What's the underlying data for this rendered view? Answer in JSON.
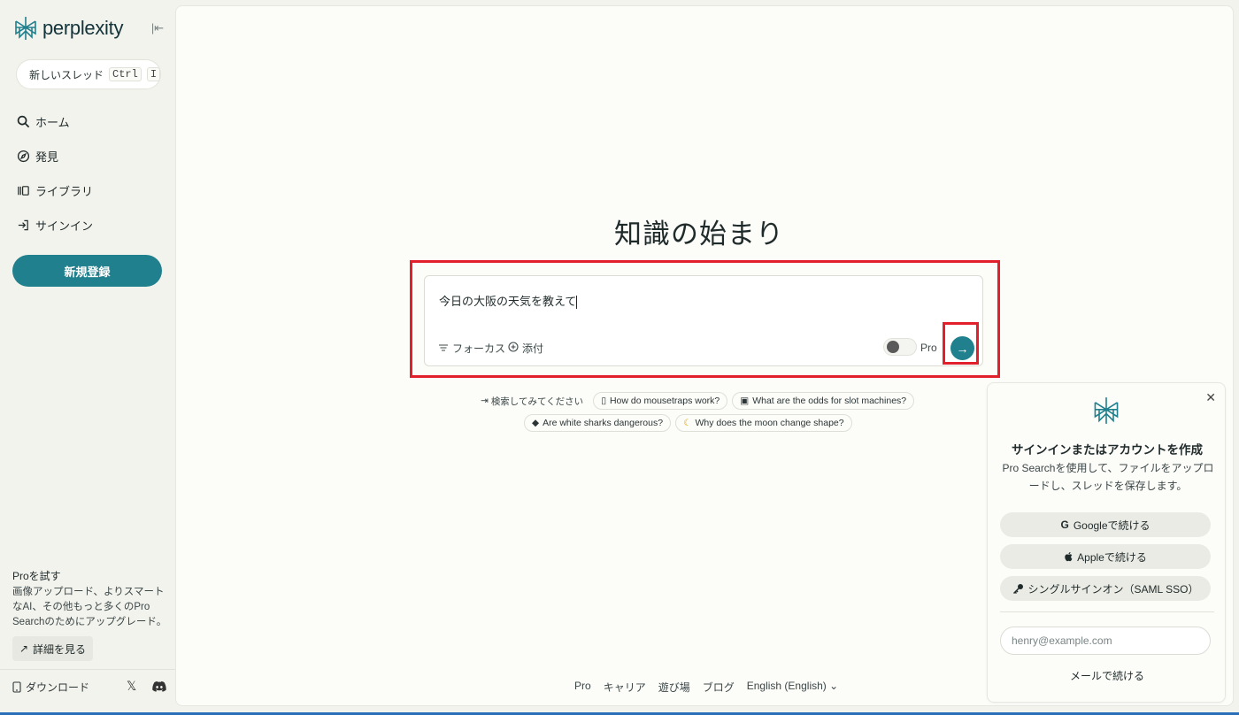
{
  "brand": {
    "name": "perplexity"
  },
  "sidebar": {
    "new_thread": {
      "label": "新しいスレッド",
      "kbd1": "Ctrl",
      "kbd2": "I"
    },
    "nav": [
      {
        "label": "ホーム",
        "icon": "search-icon"
      },
      {
        "label": "発見",
        "icon": "compass-icon"
      },
      {
        "label": "ライブラリ",
        "icon": "library-icon"
      },
      {
        "label": "サインイン",
        "icon": "signin-icon"
      }
    ],
    "signup_label": "新規登録",
    "pro_title": "Proを試す",
    "pro_desc": "画像アップロード、よりスマートなAI、その他もっと多くのPro Searchのためにアップグレード。",
    "details_label": "詳細を見る",
    "download_label": "ダウンロード"
  },
  "main": {
    "hero": "知識の始まり",
    "search": {
      "value": "今日の大阪の天気を教えて",
      "focus_label": "フォーカス",
      "attach_label": "添付",
      "pro_label": "Pro"
    },
    "suggestions": {
      "lead": "検索してみてください",
      "row1": [
        "How do mousetraps work?",
        "What are the odds for slot machines?"
      ],
      "row2": [
        "Are white sharks dangerous?",
        "Why does the moon change shape?"
      ]
    },
    "footer": [
      "Pro",
      "キャリア",
      "遊び場",
      "ブログ",
      "English (English)"
    ]
  },
  "signin_card": {
    "title": "サインインまたはアカウントを作成",
    "desc": "Pro Searchを使用して、ファイルをアップロードし、スレッドを保存します。",
    "google_label": "Googleで続ける",
    "apple_label": "Appleで続ける",
    "sso_label": "シングルサインオン（SAML SSO）",
    "email_placeholder": "henry@example.com",
    "email_continue": "メールで続ける"
  },
  "colors": {
    "accent": "#20808d",
    "highlight": "#e1202c",
    "background": "#f3f3ee"
  }
}
